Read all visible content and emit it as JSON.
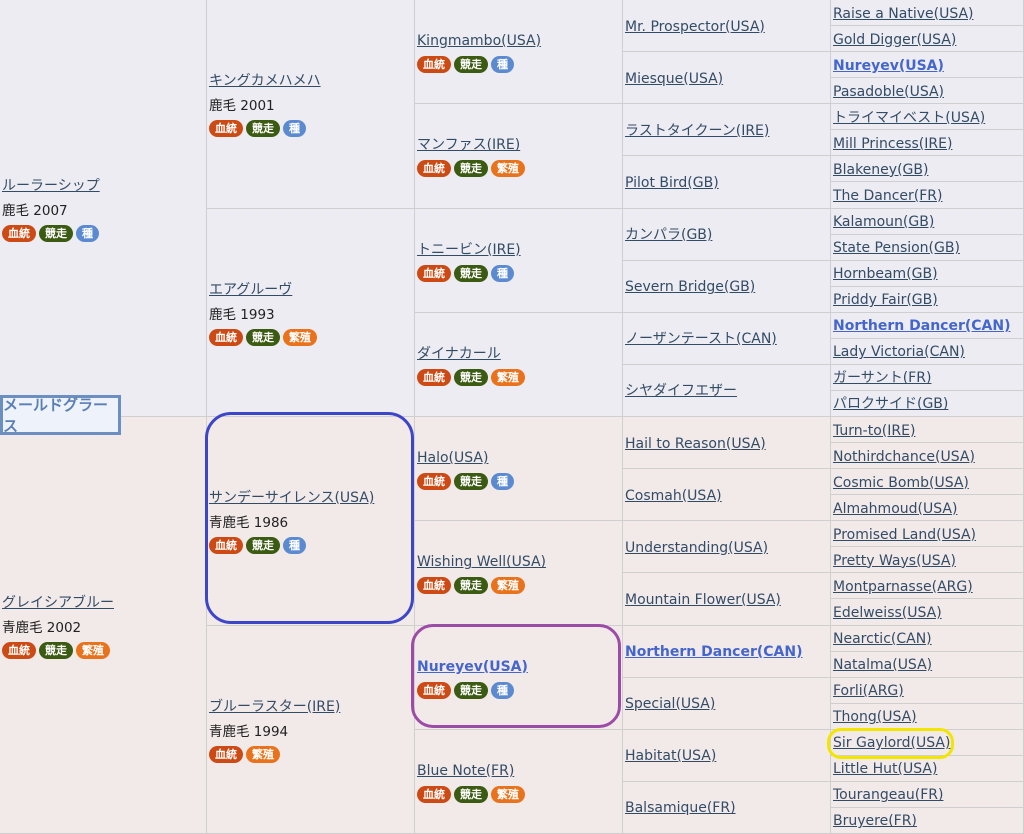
{
  "subject": "メールドグラース",
  "badge_labels": {
    "ketto": "血統",
    "kyoso": "競走",
    "shu": "種",
    "hanshoku": "繁殖"
  },
  "gen1": [
    {
      "name": "ルーラーシップ",
      "info": "鹿毛 2007",
      "badges": [
        "ketto",
        "kyoso",
        "shu"
      ]
    },
    {
      "name": "グレイシアブルー",
      "info": "青鹿毛 2002",
      "badges": [
        "ketto",
        "kyoso",
        "hanshoku"
      ]
    }
  ],
  "gen2": [
    {
      "name": "キングカメハメハ",
      "info": "鹿毛 2001",
      "badges": [
        "ketto",
        "kyoso",
        "shu"
      ]
    },
    {
      "name": "エアグルーヴ",
      "info": "鹿毛 1993",
      "badges": [
        "ketto",
        "kyoso",
        "hanshoku"
      ]
    },
    {
      "name": "サンデーサイレンス(USA)",
      "info": "青鹿毛 1986",
      "badges": [
        "ketto",
        "kyoso",
        "shu"
      ]
    },
    {
      "name": "ブルーラスター(IRE)",
      "info": "青鹿毛 1994",
      "badges": [
        "ketto",
        "hanshoku"
      ]
    }
  ],
  "gen3": [
    {
      "name": "Kingmambo(USA)",
      "badges": [
        "ketto",
        "kyoso",
        "shu"
      ]
    },
    {
      "name": "マンファス(IRE)",
      "badges": [
        "ketto",
        "kyoso",
        "hanshoku"
      ]
    },
    {
      "name": "トニービン(IRE)",
      "badges": [
        "ketto",
        "kyoso",
        "shu"
      ]
    },
    {
      "name": "ダイナカール",
      "badges": [
        "ketto",
        "kyoso",
        "hanshoku"
      ]
    },
    {
      "name": "Halo(USA)",
      "badges": [
        "ketto",
        "kyoso",
        "shu"
      ]
    },
    {
      "name": "Wishing Well(USA)",
      "badges": [
        "ketto",
        "kyoso",
        "hanshoku"
      ]
    },
    {
      "name": "Nureyev(USA)",
      "bold": true,
      "badges": [
        "ketto",
        "kyoso",
        "shu"
      ]
    },
    {
      "name": "Blue Note(FR)",
      "badges": [
        "ketto",
        "kyoso",
        "hanshoku"
      ]
    }
  ],
  "gen4": [
    {
      "name": "Mr. Prospector(USA)"
    },
    {
      "name": "Miesque(USA)"
    },
    {
      "name": "ラストタイクーン(IRE)"
    },
    {
      "name": "Pilot Bird(GB)"
    },
    {
      "name": "カンパラ(GB)"
    },
    {
      "name": "Severn Bridge(GB)"
    },
    {
      "name": "ノーザンテースト(CAN)"
    },
    {
      "name": "シヤダイフエザー"
    },
    {
      "name": "Hail to Reason(USA)"
    },
    {
      "name": "Cosmah(USA)"
    },
    {
      "name": "Understanding(USA)"
    },
    {
      "name": "Mountain Flower(USA)"
    },
    {
      "name": "Northern Dancer(CAN)",
      "bold": true
    },
    {
      "name": "Special(USA)"
    },
    {
      "name": "Habitat(USA)"
    },
    {
      "name": "Balsamique(FR)"
    }
  ],
  "gen5": [
    {
      "name": "Raise a Native(USA)"
    },
    {
      "name": "Gold Digger(USA)"
    },
    {
      "name": "Nureyev(USA)",
      "bold": true
    },
    {
      "name": "Pasadoble(USA)"
    },
    {
      "name": "トライマイベスト(USA)"
    },
    {
      "name": "Mill Princess(IRE)"
    },
    {
      "name": "Blakeney(GB)"
    },
    {
      "name": "The Dancer(FR)"
    },
    {
      "name": "Kalamoun(GB)"
    },
    {
      "name": "State Pension(GB)"
    },
    {
      "name": "Hornbeam(GB)"
    },
    {
      "name": "Priddy Fair(GB)"
    },
    {
      "name": "Northern Dancer(CAN)",
      "bold": true
    },
    {
      "name": "Lady Victoria(CAN)"
    },
    {
      "name": "ガーサント(FR)"
    },
    {
      "name": "パロクサイド(GB)"
    },
    {
      "name": "Turn-to(IRE)"
    },
    {
      "name": "Nothirdchance(USA)"
    },
    {
      "name": "Cosmic Bomb(USA)"
    },
    {
      "name": "Almahmoud(USA)"
    },
    {
      "name": "Promised Land(USA)"
    },
    {
      "name": "Pretty Ways(USA)"
    },
    {
      "name": "Montparnasse(ARG)"
    },
    {
      "name": "Edelweiss(USA)"
    },
    {
      "name": "Nearctic(CAN)"
    },
    {
      "name": "Natalma(USA)"
    },
    {
      "name": "Forli(ARG)"
    },
    {
      "name": "Thong(USA)"
    },
    {
      "name": "Sir Gaylord(USA)"
    },
    {
      "name": "Little Hut(USA)"
    },
    {
      "name": "Tourangeau(FR)"
    },
    {
      "name": "Bruyere(FR)"
    }
  ],
  "highlight_colors": {
    "blue": "#3d45c8",
    "purple": "#9c4ca6",
    "yellow": "#f2e600"
  }
}
